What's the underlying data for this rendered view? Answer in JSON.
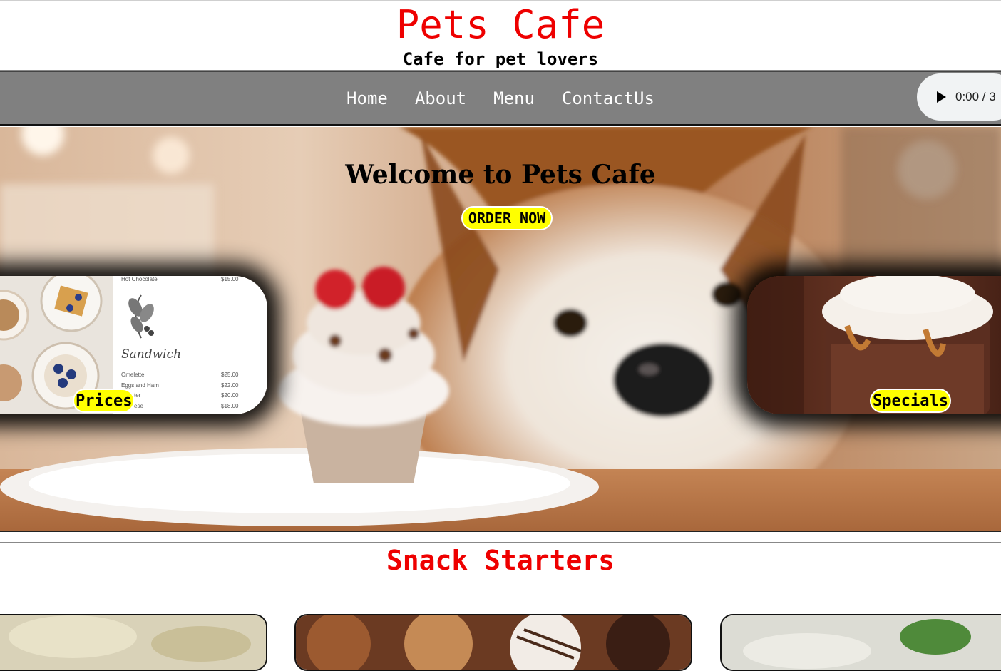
{
  "header": {
    "title": "Pets Cafe",
    "tagline": "Cafe for pet lovers"
  },
  "nav": {
    "items": [
      {
        "label": "Home"
      },
      {
        "label": "About"
      },
      {
        "label": "Menu"
      },
      {
        "label": "ContactUs"
      }
    ]
  },
  "audio": {
    "time": "0:00 / 3"
  },
  "hero": {
    "title": "Welcome to Pets Cafe",
    "order_button": "ORDER NOW",
    "cards": {
      "prices_label": "Prices",
      "specials_label": "Specials"
    },
    "menu_sheet": {
      "top_item": "Hot Chocolate",
      "top_price": "$15.00",
      "heading": "Sandwich",
      "items": [
        {
          "name": "Omelette",
          "price": "$25.00"
        },
        {
          "name": "Eggs and Ham",
          "price": "$22.00"
        },
        {
          "name": "ter",
          "price": "$20.00"
        },
        {
          "name": "ese",
          "price": "$18.00"
        }
      ]
    }
  },
  "snacks": {
    "title": "Snack Starters"
  },
  "colors": {
    "brand_red": "#ee0000",
    "nav_gray": "#808080",
    "highlight_yellow": "#ffff00"
  }
}
